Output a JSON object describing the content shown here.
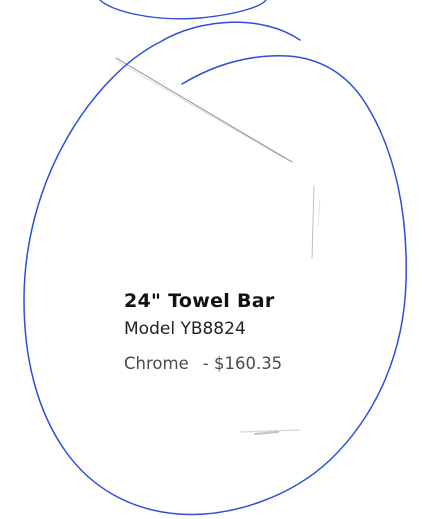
{
  "product": {
    "name": "24\" Towel Bar",
    "model": "Model YB8824",
    "finish": "Chrome",
    "separator": "-",
    "price": "$160.35"
  },
  "colors": {
    "ink": "#2b4fd6",
    "text": "#111111",
    "muted_text": "#4a4a4a",
    "sketch_gray": "#8a8a8a"
  }
}
